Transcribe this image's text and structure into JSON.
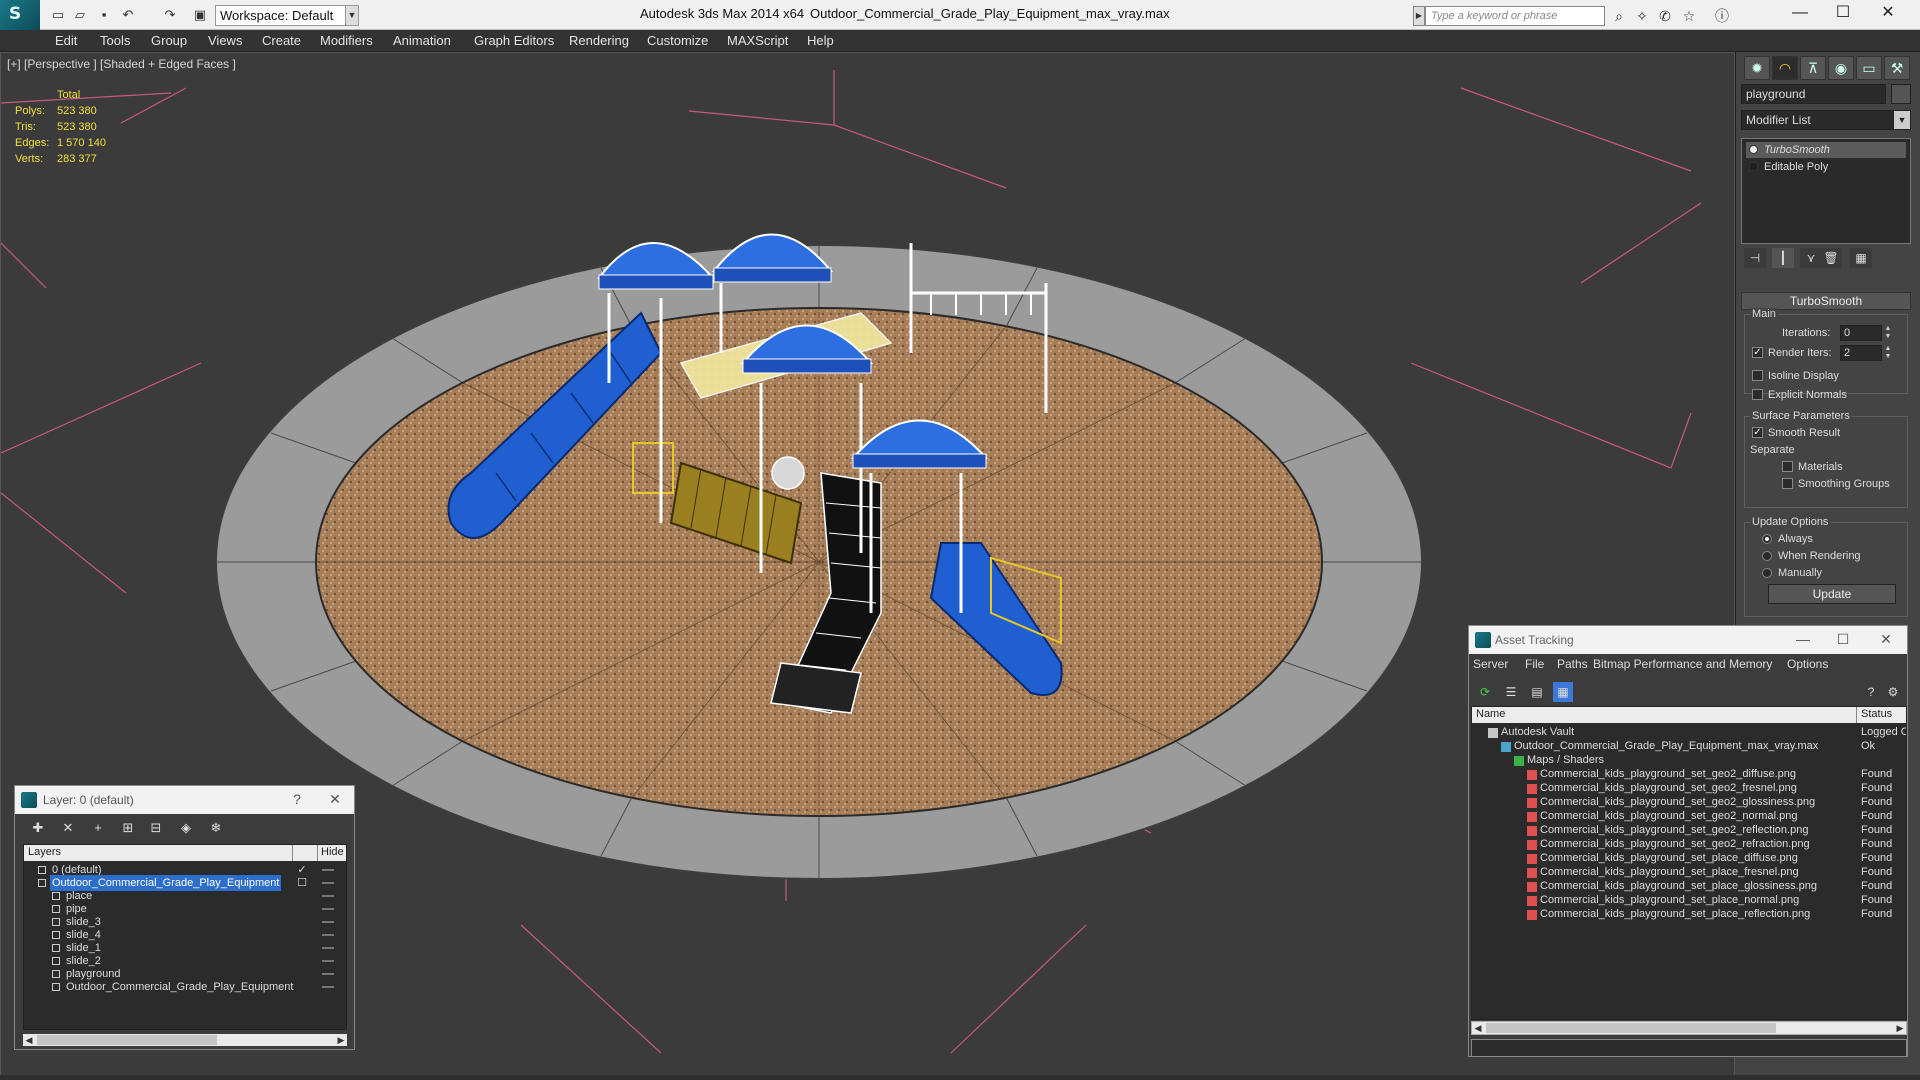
{
  "titlebar": {
    "app_title": "Autodesk 3ds Max  2014 x64",
    "file_title": "Outdoor_Commercial_Grade_Play_Equipment_max_vray.max",
    "workspace": "Workspace: Default",
    "search_placeholder": "Type a keyword or phrase"
  },
  "menu": [
    "Edit",
    "Tools",
    "Group",
    "Views",
    "Create",
    "Modifiers",
    "Animation",
    "Graph Editors",
    "Rendering",
    "Customize",
    "MAXScript",
    "Help"
  ],
  "viewport": {
    "label": "[+] [Perspective ] [Shaded + Edged Faces ]",
    "stats": {
      "header": "Total",
      "rows": [
        {
          "label": "Polys:",
          "value": "523 380"
        },
        {
          "label": "Tris:",
          "value": "523 380"
        },
        {
          "label": "Edges:",
          "value": "1 570 140"
        },
        {
          "label": "Verts:",
          "value": "283 377"
        }
      ]
    },
    "colors": {
      "ground": "#a07a55",
      "border_tiles": "#9d9d9d",
      "plastic_blue": "#1f5fd0",
      "accent_yellow": "#e6c52a",
      "wire": "#ffffff",
      "grid_lines": "#c9587e"
    }
  },
  "cmdpanel": {
    "object_name": "playground",
    "modifier_list": "Modifier List",
    "stack": [
      "TurboSmooth",
      "Editable Poly"
    ],
    "rollout": "TurboSmooth",
    "main_label": "Main",
    "iterations_label": "Iterations:",
    "iterations": "0",
    "render_iters_label": "Render Iters:",
    "render_iters": "2",
    "isoline": "Isoline Display",
    "explicit_normals": "Explicit Normals",
    "surface_params": "Surface Parameters",
    "smooth_result": "Smooth Result",
    "separate": "Separate",
    "materials": "Materials",
    "smoothing_groups": "Smoothing Groups",
    "update_options": "Update Options",
    "always": "Always",
    "when_rendering": "When Rendering",
    "manually": "Manually",
    "update_btn": "Update"
  },
  "layer_dialog": {
    "title": "Layer: 0 (default)",
    "help": "?",
    "col_layers": "Layers",
    "col_hide": "Hide",
    "rows": [
      {
        "name": "0 (default)",
        "indent": 0,
        "selected": false
      },
      {
        "name": "Outdoor_Commercial_Grade_Play_Equipment",
        "indent": 0,
        "selected": true
      },
      {
        "name": "place",
        "indent": 1,
        "selected": false
      },
      {
        "name": "pipe",
        "indent": 1,
        "selected": false
      },
      {
        "name": "slide_3",
        "indent": 1,
        "selected": false
      },
      {
        "name": "slide_4",
        "indent": 1,
        "selected": false
      },
      {
        "name": "slide_1",
        "indent": 1,
        "selected": false
      },
      {
        "name": "slide_2",
        "indent": 1,
        "selected": false
      },
      {
        "name": "playground",
        "indent": 1,
        "selected": false
      },
      {
        "name": "Outdoor_Commercial_Grade_Play_Equipment",
        "indent": 1,
        "selected": false
      }
    ]
  },
  "asset_dialog": {
    "title": "Asset Tracking",
    "menu": [
      "Server",
      "File",
      "Paths",
      "Bitmap Performance and Memory",
      "Options"
    ],
    "col_name": "Name",
    "col_status": "Status",
    "rows": [
      {
        "name": "Autodesk Vault",
        "status": "Logged O",
        "indent": 0,
        "icon": "vault"
      },
      {
        "name": "Outdoor_Commercial_Grade_Play_Equipment_max_vray.max",
        "status": "Ok",
        "indent": 1,
        "icon": "max"
      },
      {
        "name": "Maps / Shaders",
        "status": "",
        "indent": 2,
        "icon": "maps"
      },
      {
        "name": "Commercial_kids_playground_set_geo2_diffuse.png",
        "status": "Found",
        "indent": 3,
        "icon": "png"
      },
      {
        "name": "Commercial_kids_playground_set_geo2_fresnel.png",
        "status": "Found",
        "indent": 3,
        "icon": "png"
      },
      {
        "name": "Commercial_kids_playground_set_geo2_glossiness.png",
        "status": "Found",
        "indent": 3,
        "icon": "png"
      },
      {
        "name": "Commercial_kids_playground_set_geo2_normal.png",
        "status": "Found",
        "indent": 3,
        "icon": "png"
      },
      {
        "name": "Commercial_kids_playground_set_geo2_reflection.png",
        "status": "Found",
        "indent": 3,
        "icon": "png"
      },
      {
        "name": "Commercial_kids_playground_set_geo2_refraction.png",
        "status": "Found",
        "indent": 3,
        "icon": "png"
      },
      {
        "name": "Commercial_kids_playground_set_place_diffuse.png",
        "status": "Found",
        "indent": 3,
        "icon": "png"
      },
      {
        "name": "Commercial_kids_playground_set_place_fresnel.png",
        "status": "Found",
        "indent": 3,
        "icon": "png"
      },
      {
        "name": "Commercial_kids_playground_set_place_glossiness.png",
        "status": "Found",
        "indent": 3,
        "icon": "png"
      },
      {
        "name": "Commercial_kids_playground_set_place_normal.png",
        "status": "Found",
        "indent": 3,
        "icon": "png"
      },
      {
        "name": "Commercial_kids_playground_set_place_reflection.png",
        "status": "Found",
        "indent": 3,
        "icon": "png"
      }
    ]
  }
}
